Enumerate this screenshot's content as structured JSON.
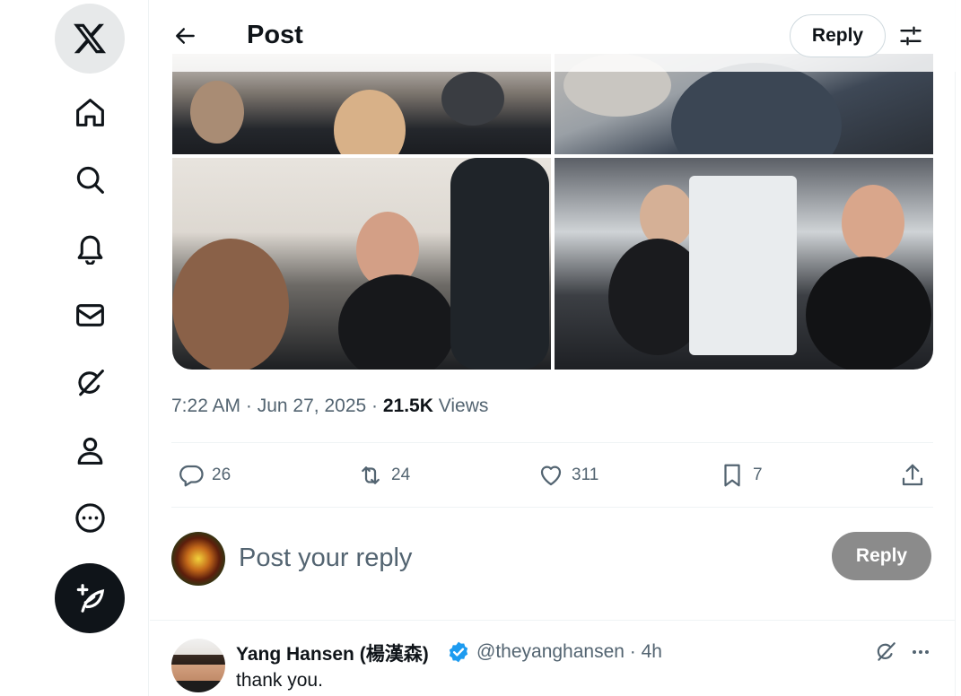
{
  "nav": {
    "items": [
      "X home logo",
      "Home",
      "Explore",
      "Notifications",
      "Messages",
      "Grok",
      "Profile",
      "More",
      "Post"
    ],
    "icons": [
      "x-logo-icon",
      "home-icon",
      "search-icon",
      "bell-icon",
      "mail-icon",
      "grok-icon",
      "person-icon",
      "more-circle-icon",
      "compose-icon"
    ]
  },
  "header": {
    "title": "Post",
    "reply_label": "Reply"
  },
  "tweet": {
    "time": "7:22 AM",
    "date": "Jun 27, 2025",
    "views_count": "21.5K",
    "views_label": "Views",
    "replies": "26",
    "reposts": "24",
    "likes": "311",
    "bookmarks": "7"
  },
  "composer": {
    "placeholder": "Post your reply",
    "button_label": "Reply",
    "button_color": "#8b8b8b"
  },
  "reply": {
    "name": "Yang Hansen (楊漢森)",
    "handle": "@theyanghansen",
    "time": "· 4h",
    "text": "thank you."
  },
  "colors": {
    "text": "#0f1419",
    "muted": "#536471",
    "border": "#eff3f4",
    "verified": "#1d9bf0"
  }
}
